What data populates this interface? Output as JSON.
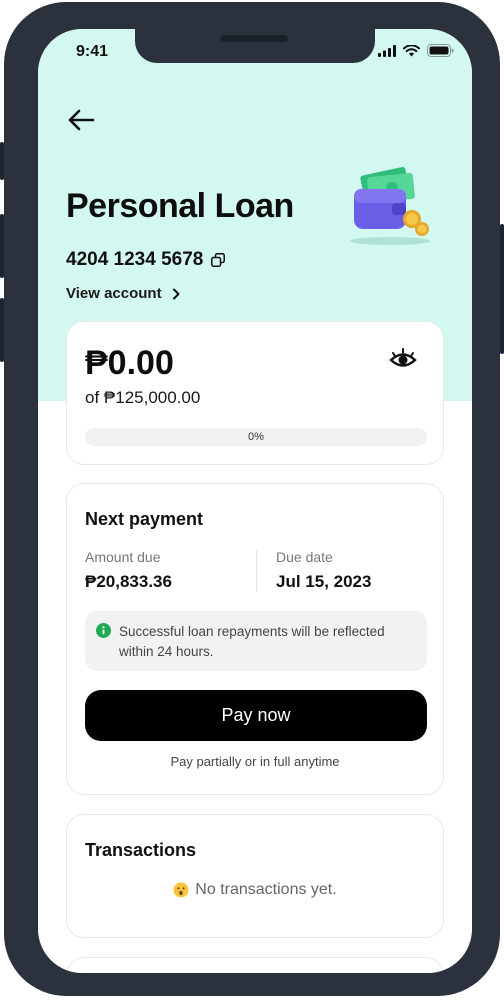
{
  "status_bar": {
    "time": "9:41"
  },
  "header": {
    "title": "Personal Loan",
    "account_number": "4204 1234 5678",
    "view_account_label": "View account"
  },
  "balance": {
    "amount": "₱0.00",
    "limit_text": "of ₱125,000.00",
    "progress_fraction": 0,
    "progress_label": "0%"
  },
  "next_payment": {
    "title": "Next payment",
    "amount_due_label": "Amount due",
    "amount_due_value": "₱20,833.36",
    "due_date_label": "Due date",
    "due_date_value": "Jul 15, 2023",
    "notice": "Successful loan repayments will be reflected within 24 hours.",
    "pay_button": "Pay now",
    "pay_note": "Pay partially or in full anytime"
  },
  "transactions": {
    "title": "Transactions",
    "empty_text": "No transactions yet."
  },
  "icons": {
    "back": "arrow-left-icon",
    "copy": "copy-icon",
    "chevron": "chevron-right-icon",
    "eye": "eye-icon",
    "info": "info-icon",
    "emoji": "surprised-face-icon"
  },
  "colors": {
    "hero_background": "#d3f8ef",
    "accent_green": "#1ecb8f",
    "button_black": "#000000"
  }
}
